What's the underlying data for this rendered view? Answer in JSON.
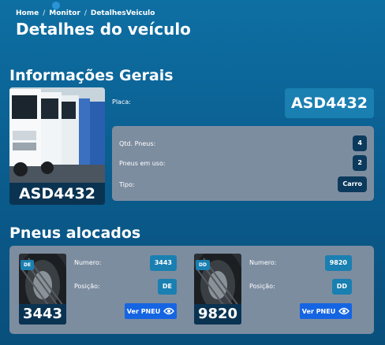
{
  "breadcrumb": {
    "home": "Home",
    "monitor": "Monitor",
    "current": "DetalhesVeiculo",
    "sep": "/"
  },
  "page_title": "Detalhes do veículo",
  "general": {
    "title": "Informações Gerais",
    "plate_caption": "ASD4432",
    "placa_label": "Placa:",
    "placa_value": "ASD4432",
    "rows": [
      {
        "label": "Qtd. Pneus:",
        "value": "4"
      },
      {
        "label": "Pneus em uso:",
        "value": "2"
      },
      {
        "label": "Tipo:",
        "value": "Carro"
      }
    ]
  },
  "tires": {
    "title": "Pneus alocados",
    "numero_label": "Numero:",
    "posicao_label": "Posição:",
    "button_label": "Ver PNEU",
    "items": [
      {
        "tag": "DE",
        "number": "3443",
        "position": "DE"
      },
      {
        "tag": "DD",
        "number": "9820",
        "position": "DD"
      }
    ]
  },
  "colors": {
    "accent": "#1a7fb1",
    "button": "#1565e3",
    "panel": "#7d8da0",
    "dark": "#0a3352"
  }
}
